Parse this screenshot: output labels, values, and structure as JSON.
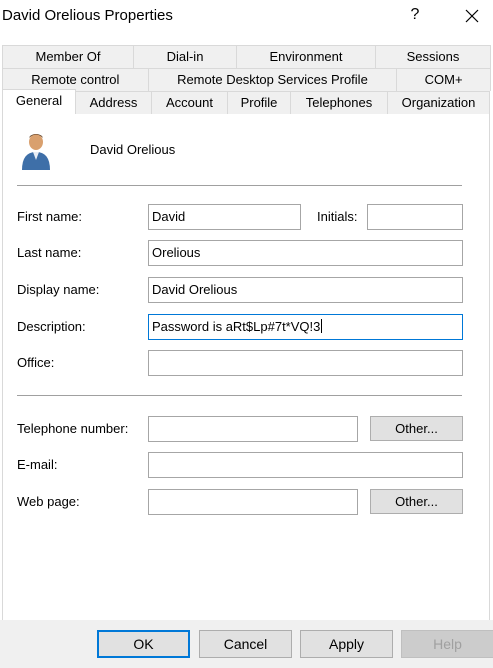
{
  "window": {
    "title": "David Orelious Properties",
    "help_glyph": "?"
  },
  "tabs": {
    "row1": [
      "Member Of",
      "Dial-in",
      "Environment",
      "Sessions"
    ],
    "row2": [
      "Remote control",
      "Remote Desktop Services Profile",
      "COM+"
    ],
    "row3": [
      "General",
      "Address",
      "Account",
      "Profile",
      "Telephones",
      "Organization"
    ],
    "active": "General"
  },
  "user": {
    "display": "David Orelious",
    "icon": "user-avatar-icon"
  },
  "form": {
    "first_name_label": "First name:",
    "first_name_value": "David",
    "initials_label": "Initials:",
    "initials_value": "",
    "last_name_label": "Last name:",
    "last_name_value": "Orelious",
    "display_name_label": "Display name:",
    "display_name_value": "David Orelious",
    "description_label": "Description:",
    "description_value": "Password is aRt$Lp#7t*VQ!3",
    "office_label": "Office:",
    "office_value": "",
    "telephone_label": "Telephone number:",
    "telephone_value": "",
    "email_label": "E-mail:",
    "email_value": "",
    "webpage_label": "Web page:",
    "webpage_value": "",
    "other_label": "Other..."
  },
  "buttons": {
    "ok": "OK",
    "cancel": "Cancel",
    "apply": "Apply",
    "help": "Help"
  },
  "colors": {
    "accent": "#0078d7",
    "button_face": "#e1e1e1",
    "tab_face": "#f0f0f0",
    "disabled_text": "#a0a0a0"
  }
}
